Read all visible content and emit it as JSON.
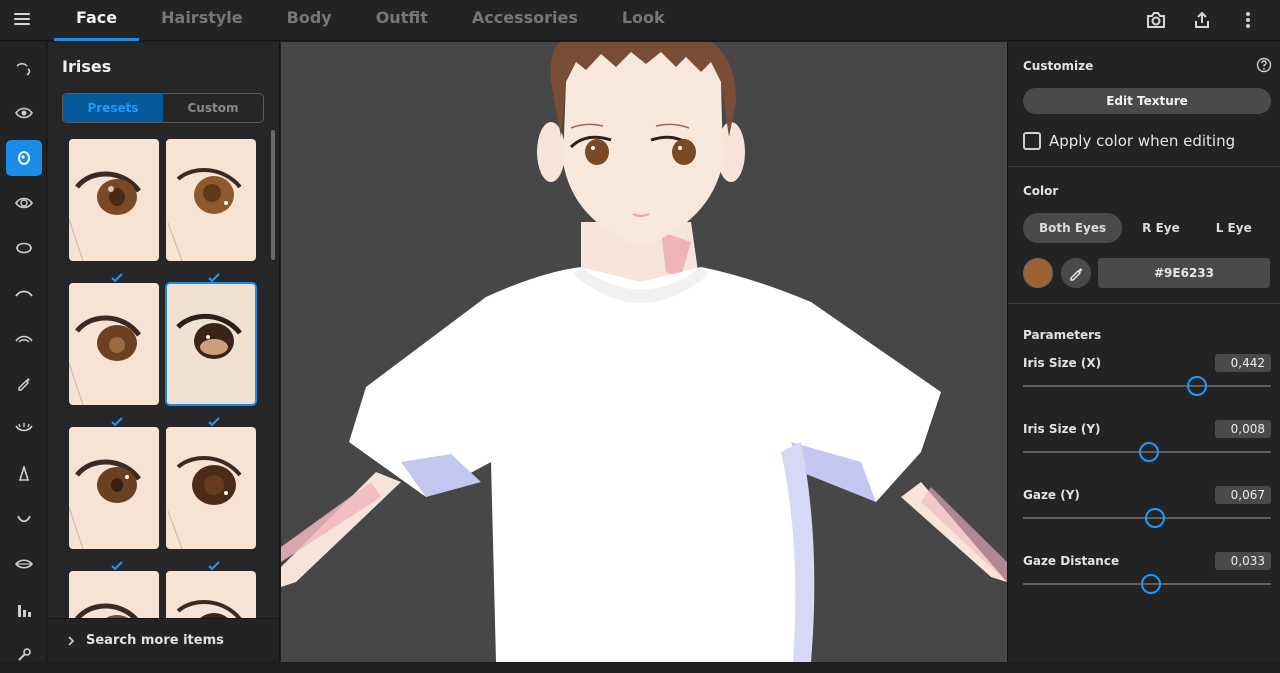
{
  "topbar": {
    "tabs": [
      "Face",
      "Hairstyle",
      "Body",
      "Outfit",
      "Accessories",
      "Look"
    ],
    "active_tab": "Face"
  },
  "rail": {
    "icons": [
      "brow-icon",
      "eye-icon",
      "iris-icon",
      "eye-highlight-icon",
      "eye-white-icon",
      "eyeline-icon",
      "eyelash-icon",
      "eyedropper-icon",
      "lower-lash-icon",
      "nose-icon",
      "mouth-icon",
      "lip-icon",
      "bar-chart-icon",
      "wrench-icon"
    ],
    "active_index": 2
  },
  "presets_panel": {
    "title": "Irises",
    "seg_presets": "Presets",
    "seg_custom": "Custom",
    "search_more": "Search more items"
  },
  "right_panel": {
    "customize_title": "Customize",
    "edit_texture": "Edit Texture",
    "apply_color": "Apply color when editing",
    "color_title": "Color",
    "eye_both": "Both Eyes",
    "eye_r": "R Eye",
    "eye_l": "L Eye",
    "color_hex": "#9E6233",
    "swatch_color": "#9E6233",
    "params_title": "Parameters",
    "params": [
      {
        "label": "Iris Size (X)",
        "value": "0,442",
        "level": 0.7
      },
      {
        "label": "Iris Size (Y)",
        "value": "0,008",
        "level": 0.508
      },
      {
        "label": "Gaze (Y)",
        "value": "0,067",
        "level": 0.534
      },
      {
        "label": "Gaze Distance",
        "value": "0,033",
        "level": 0.516
      }
    ]
  },
  "colors": {
    "accent": "#1A8EE6",
    "iris": "#9E6233"
  }
}
